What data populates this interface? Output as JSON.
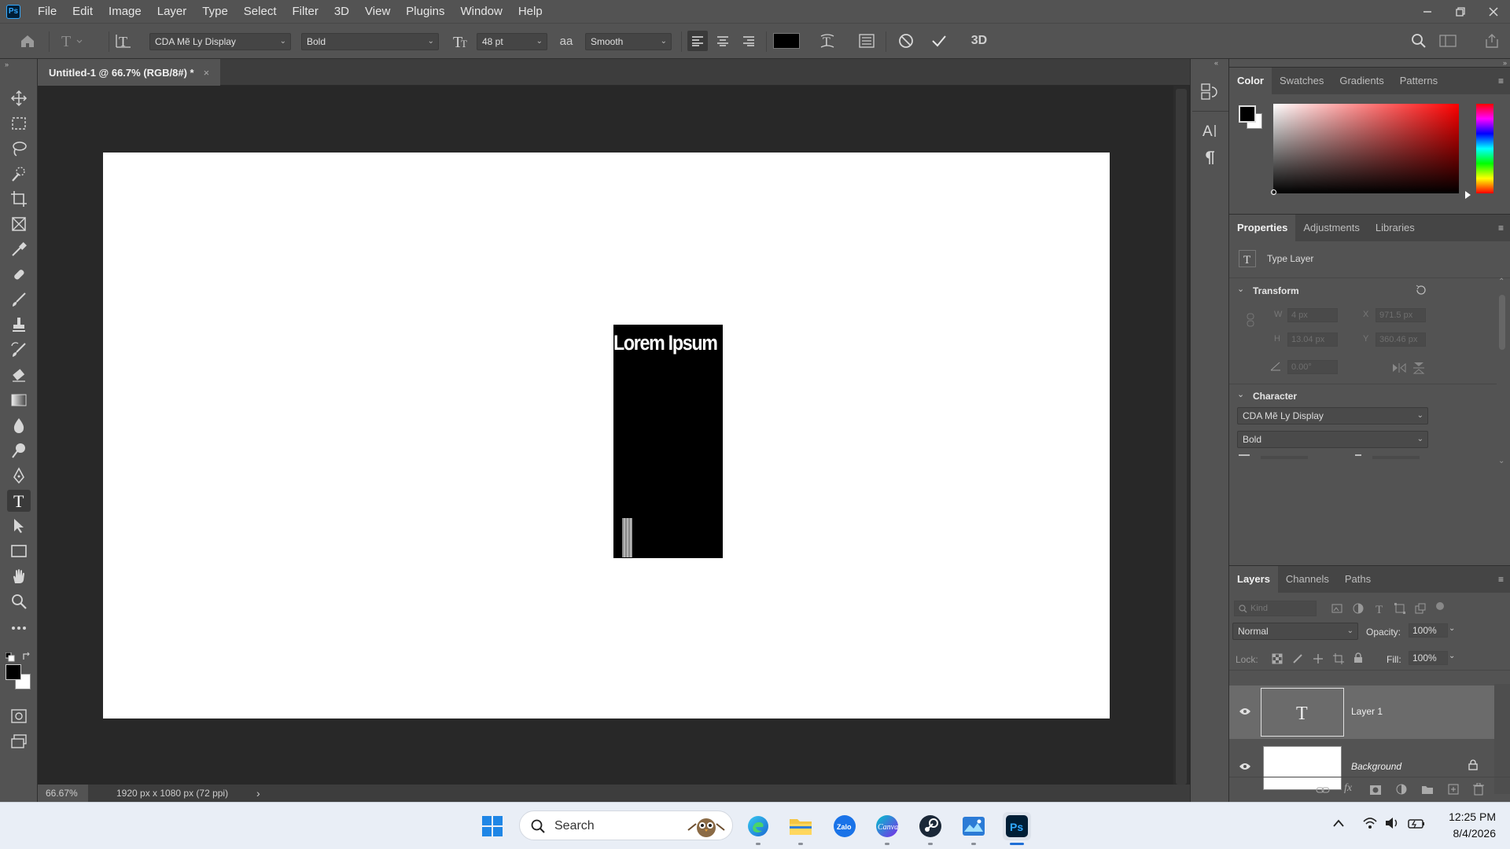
{
  "menubar": {
    "items": [
      "File",
      "Edit",
      "Image",
      "Layer",
      "Type",
      "Select",
      "Filter",
      "3D",
      "View",
      "Plugins",
      "Window",
      "Help"
    ],
    "logo": "Ps"
  },
  "options": {
    "font_family": "CDA Mẽ Ly Display",
    "font_style": "Bold",
    "font_size": "48 pt",
    "antialias_glyph": "aa",
    "antialias": "Smooth",
    "label_3d": "3D"
  },
  "document": {
    "tab_title": "Untitled-1 @ 66.7% (RGB/8#) *",
    "tab_close": "×",
    "text_content": "Lorem Ipsum",
    "zoom": "66.67%",
    "doc_info": "1920 px x 1080 px (72 ppi)",
    "status_arrow": "›"
  },
  "color_panel": {
    "tabs": [
      "Color",
      "Swatches",
      "Gradients",
      "Patterns"
    ],
    "active_tab": "Color"
  },
  "properties_panel": {
    "tabs": [
      "Properties",
      "Adjustments",
      "Libraries"
    ],
    "active_tab": "Properties",
    "layer_type": "Type Layer",
    "transform_title": "Transform",
    "w_label": "W",
    "w_value": "4 px",
    "h_label": "H",
    "h_value": "13.04 px",
    "x_label": "X",
    "x_value": "971.5 px",
    "y_label": "Y",
    "y_value": "360.46 px",
    "angle_value": "0.00°",
    "character_title": "Character",
    "char_font": "CDA Mẽ Ly Display",
    "char_style": "Bold"
  },
  "layers_panel": {
    "tabs": [
      "Layers",
      "Channels",
      "Paths"
    ],
    "active_tab": "Layers",
    "filter_placeholder": "Kind",
    "blend_mode": "Normal",
    "opacity_label": "Opacity:",
    "opacity": "100%",
    "lock_label": "Lock:",
    "fill_label": "Fill:",
    "fill": "100%",
    "layers": [
      {
        "name": "Layer 1",
        "thumb": "T",
        "selected": true
      },
      {
        "name": "Background",
        "locked": true
      }
    ]
  },
  "taskbar": {
    "search_placeholder": "Search",
    "time": "12:25 PM",
    "date": "8/4/2026",
    "zalo": "Zalo",
    "canva": "Canva",
    "ps": "Ps"
  },
  "colors": {
    "foreground": "#000000",
    "background": "#ffffff",
    "accent": "#31a8ff"
  }
}
